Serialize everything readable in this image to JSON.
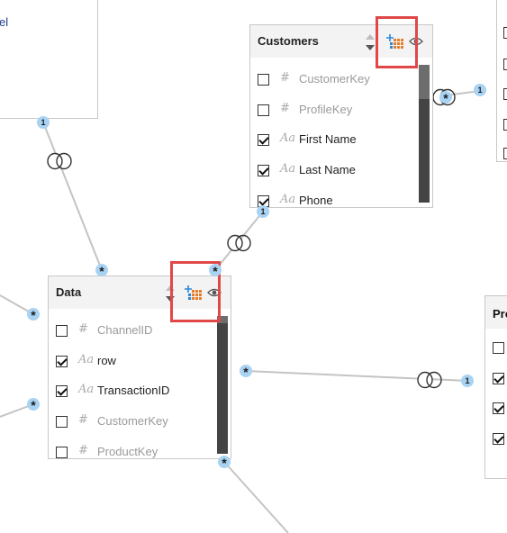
{
  "tables": {
    "customers": {
      "title": "Customers",
      "fields": [
        {
          "label": "CustomerKey",
          "type": "#",
          "checked": false
        },
        {
          "label": "ProfileKey",
          "type": "#",
          "checked": false
        },
        {
          "label": "First Name",
          "type": "Aa",
          "checked": true
        },
        {
          "label": "Last Name",
          "type": "Aa",
          "checked": true
        },
        {
          "label": "Phone",
          "type": "Aa",
          "checked": true
        }
      ]
    },
    "data": {
      "title": "Data",
      "fields": [
        {
          "label": "ChannelID",
          "type": "#",
          "checked": false
        },
        {
          "label": "row",
          "type": "Aa",
          "checked": true
        },
        {
          "label": "TransactionID",
          "type": "Aa",
          "checked": true
        },
        {
          "label": "CustomerKey",
          "type": "#",
          "checked": false
        },
        {
          "label": "ProductKey",
          "type": "#",
          "checked": false
        }
      ]
    },
    "top_left_partial": {
      "text": "el"
    },
    "right_partial": {
      "title": "Pro"
    }
  },
  "cardinality": {
    "one": "1",
    "many": "*"
  },
  "icons": {
    "new_measure": "table-add-icon",
    "visibility": "eye-icon",
    "resize": "resize-arrows-icon",
    "filter": "bidirectional-filter-icon"
  },
  "colors": {
    "highlight": "#e04848",
    "endpoint": "#a9d3f2",
    "line": "#c4c4c4"
  }
}
